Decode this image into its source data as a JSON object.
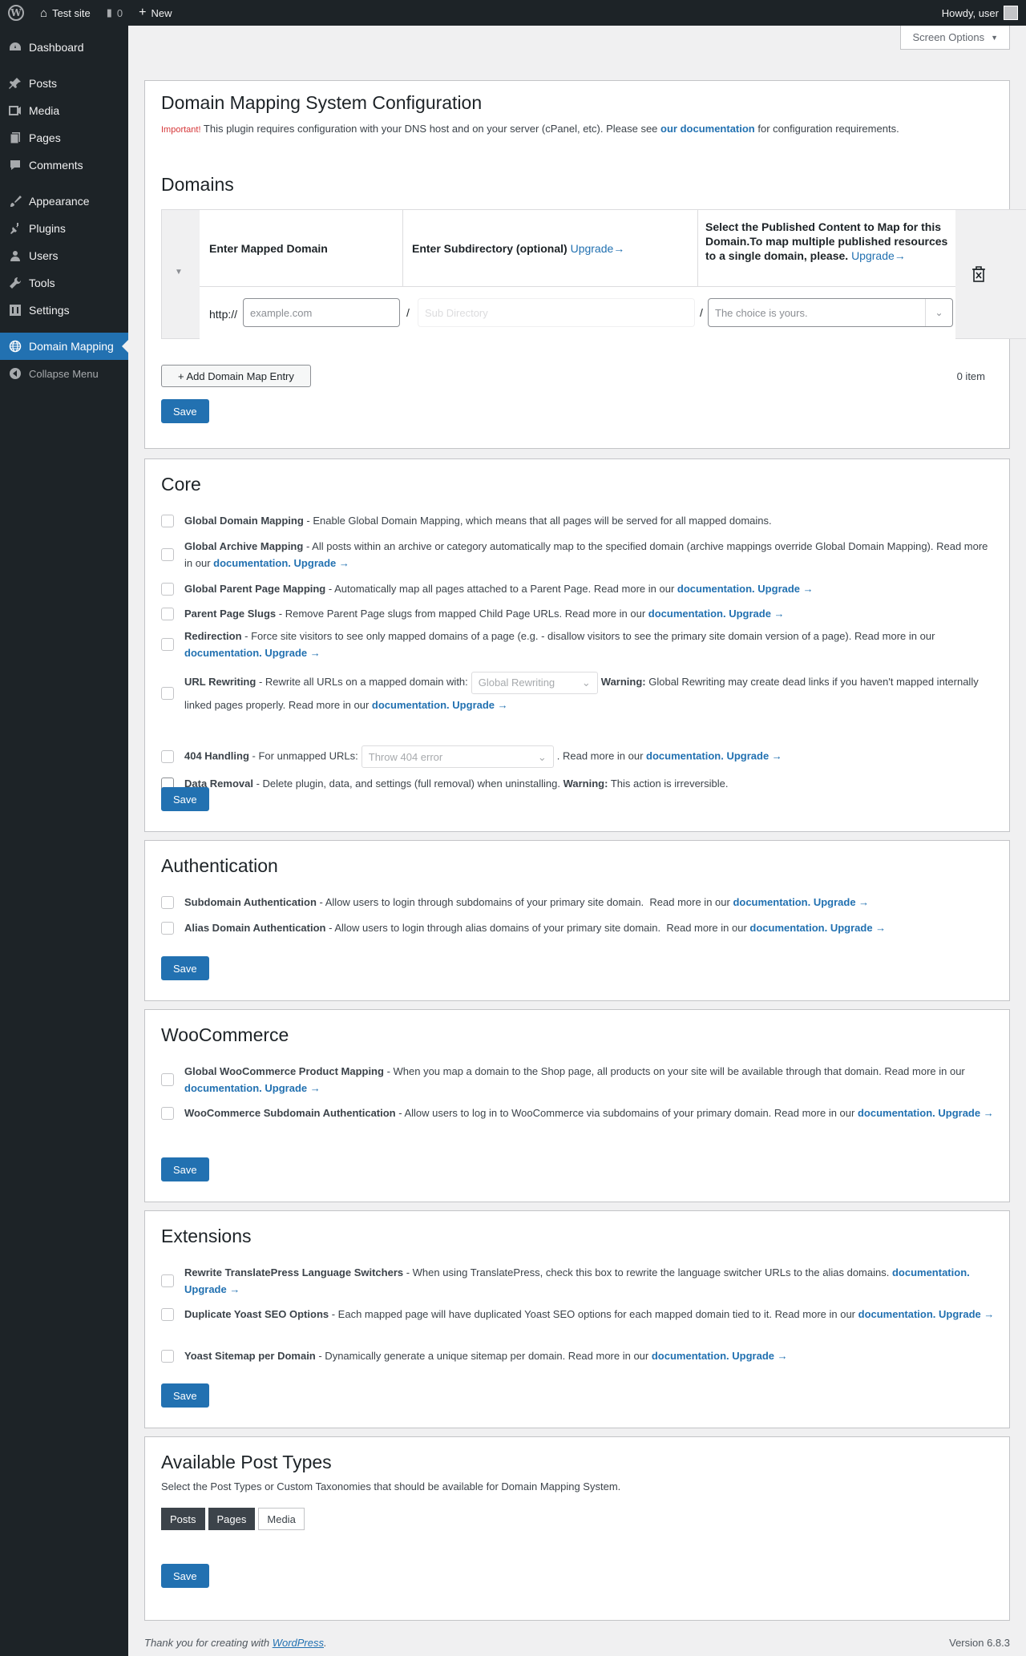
{
  "adminbar": {
    "site_name": "Test site",
    "comments_count": "0",
    "new_label": "New",
    "howdy": "Howdy, user"
  },
  "sidebar": {
    "items": [
      {
        "label": "Dashboard",
        "icon": "dashboard-icon"
      },
      {
        "label": "Posts",
        "icon": "pin-icon"
      },
      {
        "label": "Media",
        "icon": "media-icon"
      },
      {
        "label": "Pages",
        "icon": "pages-icon"
      },
      {
        "label": "Comments",
        "icon": "comment-icon"
      },
      {
        "label": "Appearance",
        "icon": "brush-icon"
      },
      {
        "label": "Plugins",
        "icon": "plug-icon"
      },
      {
        "label": "Users",
        "icon": "user-icon"
      },
      {
        "label": "Tools",
        "icon": "wrench-icon"
      },
      {
        "label": "Settings",
        "icon": "settings-icon"
      },
      {
        "label": "Domain Mapping",
        "icon": "globe-icon"
      }
    ],
    "collapse": "Collapse Menu"
  },
  "screen_options": "Screen Options",
  "config": {
    "title": "Domain Mapping System Configuration",
    "important": "Important!",
    "note_pre": " This plugin requires configuration with your DNS host and on your server (cPanel, etc). Please see ",
    "note_link": "our documentation",
    "note_post": " for configuration requirements.",
    "domains_title": "Domains",
    "col1": "Enter Mapped Domain",
    "col2": "Enter Subdirectory (optional)",
    "col2_upgrade": "Upgrade→",
    "col3": "Select the Published Content to Map for this Domain.To map multiple published resources to a single domain, please.",
    "col3_upgrade": "Upgrade→",
    "http": "http://",
    "slash": "/",
    "domain_placeholder": "example.com",
    "subdir_placeholder": "Sub Directory",
    "content_placeholder": "The choice is yours.",
    "add_entry": "+ Add Domain Map Entry",
    "item_count": "0 item",
    "save": "Save"
  },
  "core": {
    "title": "Core",
    "save": "Save",
    "doc": "documentation.",
    "upgrade": "Upgrade →",
    "options": [
      {
        "name": "Global Domain Mapping",
        "desc": " - Enable Global Domain Mapping, which means that all pages will be served for all mapped domains."
      },
      {
        "name": "Global Archive Mapping",
        "desc": " - All posts within an archive or category automatically map to the specified domain (archive mappings override Global Domain Mapping). Read more in our "
      },
      {
        "name": "Global Parent Page Mapping",
        "desc": " - Automatically map all pages attached to a Parent Page. Read more in our "
      },
      {
        "name": "Parent Page Slugs",
        "desc": " - Remove Parent Page slugs from mapped Child Page URLs. Read more in our "
      },
      {
        "name": "Redirection",
        "desc": " - Force site visitors to see only mapped domains of a page (e.g. - disallow visitors to see the primary site domain version of a page). Read more in our "
      },
      {
        "name": "URL Rewriting",
        "desc": " - Rewrite all URLs on a mapped domain with:",
        "select": "Global Rewriting",
        "warn": "Warning:",
        "desc2": " Global Rewriting may create dead links if you haven't mapped internally linked pages properly. Read more in our "
      },
      {
        "name": "404 Handling",
        "desc": " - For unmapped URLs:",
        "select": "Throw 404 error",
        "desc2": ". Read more in our "
      },
      {
        "name": "Data Removal",
        "desc": " - Delete plugin, data, and settings (full removal) when uninstalling. ",
        "warn": "Warning:",
        "desc2": " This action is irreversible."
      }
    ]
  },
  "auth": {
    "title": "Authentication",
    "save": "Save",
    "options": [
      {
        "name": "Subdomain Authentication",
        "desc": " - Allow users to login through subdomains of your primary site domain.  Read more in our "
      },
      {
        "name": "Alias Domain Authentication",
        "desc": " - Allow users to login through alias domains of your primary site domain.  Read more in our "
      }
    ]
  },
  "woo": {
    "title": "WooCommerce",
    "save": "Save",
    "options": [
      {
        "name": "Global WooCommerce Product Mapping",
        "desc": " - When you map a domain to the Shop page, all products on your site will be available through that domain. Read more in our "
      },
      {
        "name": "WooCommerce Subdomain Authentication",
        "desc": " - Allow users to log in to WooCommerce via subdomains of your primary domain. Read more in our "
      }
    ]
  },
  "ext": {
    "title": "Extensions",
    "save": "Save",
    "options": [
      {
        "name": "Rewrite TranslatePress Language Switchers",
        "desc": " - When using TranslatePress, check this box to rewrite the language switcher URLs to the alias domains. "
      },
      {
        "name": "Duplicate Yoast SEO Options",
        "desc": " - Each mapped page will have duplicated Yoast SEO options for each mapped domain tied to it. Read more in our "
      },
      {
        "name": "Yoast Sitemap per Domain",
        "desc": " - Dynamically generate a unique sitemap per domain. Read more in our "
      }
    ]
  },
  "post_types": {
    "title": "Available Post Types",
    "desc": "Select the Post Types or Custom Taxonomies that should be available for Domain Mapping System.",
    "tags": [
      "Posts",
      "Pages",
      "Media"
    ],
    "save": "Save"
  },
  "footer": {
    "thanks": "Thank you for creating with ",
    "wp_link": "WordPress",
    "period": ".",
    "version": "Version 6.8.3"
  }
}
